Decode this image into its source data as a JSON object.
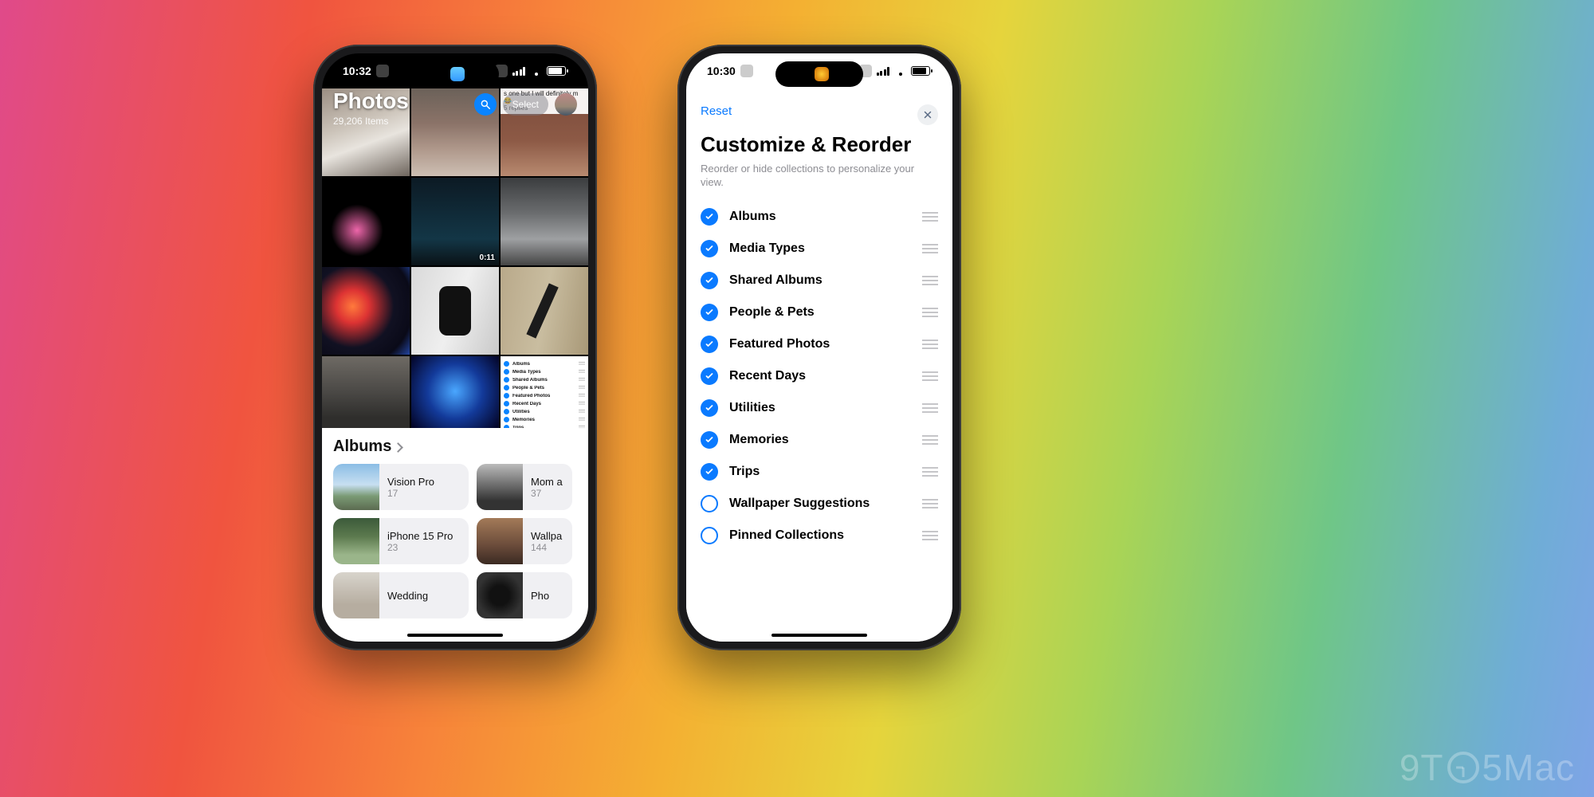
{
  "watermark": "9T  5Mac",
  "phoneLeft": {
    "status": {
      "time": "10:32"
    },
    "header": {
      "title": "Photos",
      "subtitle": "29,206 Items",
      "selectLabel": "Select"
    },
    "tiles": {
      "t2caption": "s one but I will definitely m",
      "t2replies": "5 replies",
      "t4duration": "0:11"
    },
    "miniList": [
      "Albums",
      "Media Types",
      "Shared Albums",
      "People & Pets",
      "Featured Photos",
      "Recent Days",
      "Utilities",
      "Memories",
      "Trips"
    ],
    "albumsSection": "Albums",
    "albums": [
      {
        "name": "Vision Pro",
        "count": "17"
      },
      {
        "name": "Mom a",
        "count": "37"
      },
      {
        "name": "iPhone 15 Pro",
        "count": "23"
      },
      {
        "name": "Wallpa",
        "count": "144"
      },
      {
        "name": "Wedding",
        "count": ""
      },
      {
        "name": "Pho",
        "count": ""
      }
    ]
  },
  "phoneRight": {
    "status": {
      "time": "10:30"
    },
    "reset": "Reset",
    "title": "Customize & Reorder",
    "subtitle": "Reorder or hide collections to personalize your view.",
    "options": [
      {
        "label": "Albums",
        "checked": true
      },
      {
        "label": "Media Types",
        "checked": true
      },
      {
        "label": "Shared Albums",
        "checked": true
      },
      {
        "label": "People & Pets",
        "checked": true
      },
      {
        "label": "Featured Photos",
        "checked": true
      },
      {
        "label": "Recent Days",
        "checked": true
      },
      {
        "label": "Utilities",
        "checked": true
      },
      {
        "label": "Memories",
        "checked": true
      },
      {
        "label": "Trips",
        "checked": true
      },
      {
        "label": "Wallpaper Suggestions",
        "checked": false
      },
      {
        "label": "Pinned Collections",
        "checked": false
      }
    ]
  }
}
